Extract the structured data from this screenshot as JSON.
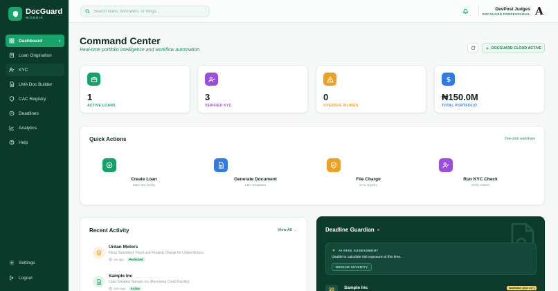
{
  "brand": {
    "name": "DocGuard",
    "sub": "NIGERIA"
  },
  "nav": [
    {
      "label": "Dashboard",
      "icon": "dashboard-icon"
    },
    {
      "label": "Loan Origination",
      "icon": "file-icon"
    },
    {
      "label": "KYC",
      "icon": "user-check-icon"
    },
    {
      "label": "LMA Doc Builder",
      "icon": "document-icon"
    },
    {
      "label": "CAC Registry",
      "icon": "shield-icon"
    },
    {
      "label": "Deadlines",
      "icon": "clock-icon"
    },
    {
      "label": "Analytics",
      "icon": "chart-icon"
    },
    {
      "label": "Help",
      "icon": "help-icon"
    }
  ],
  "nav_bottom": [
    {
      "label": "Settings",
      "icon": "gear-icon"
    },
    {
      "label": "Logout",
      "icon": "logout-icon"
    }
  ],
  "search": {
    "placeholder": "Search loans, borrowers, or filings..."
  },
  "user": {
    "name": "DevPost Judges",
    "role": "DOCGUARD PROFESSIONAL",
    "avatar": "A"
  },
  "page": {
    "title": "Command Center",
    "subtitle": "Real-time portfolio intelligence and workflow automation.",
    "cloud_status": "DOCGUARD CLOUD ACTIVE"
  },
  "stats": [
    {
      "value": "1",
      "label": "ACTIVE LOANS",
      "color": "#12a36a",
      "icon": "briefcase-icon"
    },
    {
      "value": "3",
      "label": "VERIFIED KYC",
      "color": "#9b4de0",
      "icon": "user-check-icon"
    },
    {
      "value": "0",
      "label": "OVERDUE FILINGS",
      "color": "#f0a020",
      "icon": "warning-icon"
    },
    {
      "value": "₦150.0M",
      "label": "TOTAL PORTFOLIO",
      "color": "#2f7bea",
      "icon": "dollar-icon"
    }
  ],
  "quick_actions": {
    "title": "Quick Actions",
    "link": "One-click workflows",
    "items": [
      {
        "name": "Create Loan",
        "desc": "Start new facility",
        "color": "#12a36a",
        "icon": "plus-circle-icon"
      },
      {
        "name": "Generate Document",
        "desc": "LMA templates",
        "color": "#2f7bea",
        "icon": "document-icon"
      },
      {
        "name": "File Charge",
        "desc": "CAC registry",
        "color": "#f0a020",
        "icon": "shield-icon"
      },
      {
        "name": "Run KYC Check",
        "desc": "Verify entities",
        "color": "#9b4de0",
        "icon": "user-check-icon"
      }
    ]
  },
  "recent": {
    "title": "Recent Activity",
    "link": "View All →",
    "items": [
      {
        "title": "Urdan Motors",
        "desc": "Filing Submitted: Fixed and Floating Charge for Urdan Motors",
        "time": "1m ago",
        "status": "Perfected",
        "icon": "shield-icon",
        "icon_bg": "#fdf0d8",
        "icon_color": "#e09a1a"
      },
      {
        "title": "Sample Inc",
        "desc": "Loan Created: Sample Inc (Revolving Credit Facility)",
        "time": "32m ago",
        "status": "Active",
        "icon": "document-icon",
        "icon_bg": "#e2f5ea",
        "icon_color": "#12a36a"
      }
    ]
  },
  "guardian": {
    "title": "Deadline Guardian",
    "risk_title": "AI RISK ASSESSMENT",
    "risk_text": "Unable to calculate risk exposure at this time.",
    "severity": "MEDIUM SEVERITY",
    "row": {
      "days": "30",
      "name": "Sample Inc",
      "warning": "WARNING (DAY 61+)"
    }
  }
}
